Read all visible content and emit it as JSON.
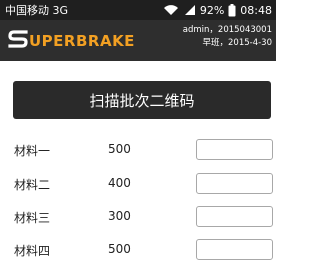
{
  "status_bar": {
    "carrier": "中国移动 3G",
    "battery": "92%",
    "time": "08:48",
    "icons": [
      "wifi-icon",
      "signal-icon",
      "battery-icon"
    ]
  },
  "header": {
    "logo_text": "UPERBRAKE",
    "user_line1": "admin，2015043001",
    "user_line2": "早班，2015-4-30",
    "logo_colors": {
      "s_mark": "#ffffff",
      "text": "#f2a023"
    }
  },
  "scan_button": {
    "label": "扫描批次二维码"
  },
  "materials": [
    {
      "name": "材料一",
      "qty": "500",
      "value": ""
    },
    {
      "name": "材料二",
      "qty": "400",
      "value": ""
    },
    {
      "name": "材料三",
      "qty": "300",
      "value": ""
    },
    {
      "name": "材料四",
      "qty": "500",
      "value": ""
    }
  ]
}
